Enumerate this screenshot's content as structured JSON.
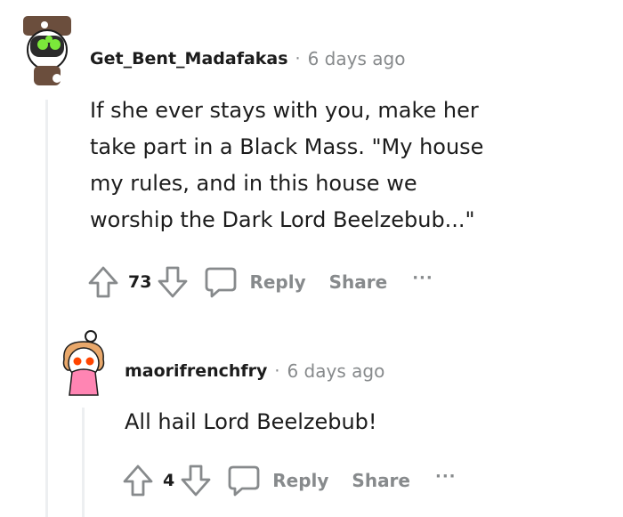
{
  "comments": [
    {
      "username": "Get_Bent_Madafakas",
      "separator": "·",
      "time": "6 days ago",
      "lines": [
        "If she ever stays with you, make her",
        "take part in a Black Mass. \"My house",
        "my rules, and in this house we",
        "worship the Dark Lord Beelzebub...\""
      ],
      "votes": "73",
      "reply_label": "Reply",
      "share_label": "Share",
      "more_label": "···"
    },
    {
      "username": "maorifrenchfry",
      "separator": "·",
      "time": "6 days ago",
      "lines": [
        "All hail Lord Beelzebub!"
      ],
      "votes": "4",
      "reply_label": "Reply",
      "share_label": "Share",
      "more_label": "···"
    }
  ],
  "icons": {
    "upvote": "arrow-up-icon",
    "downvote": "arrow-down-icon",
    "comment": "speech-bubble-icon",
    "more": "ellipsis-icon"
  },
  "colors": {
    "text": "#1c1c1c",
    "muted": "#878a8c",
    "thread_line": "#edeff1",
    "avatar1_bg": "#ffffff",
    "avatar1_hat": "#6b4e3d",
    "avatar1_eyes": "#7be83a",
    "avatar2_hair": "#e9a86b",
    "avatar2_eyes": "#ff4500",
    "avatar2_shirt": "#ff85b3"
  }
}
